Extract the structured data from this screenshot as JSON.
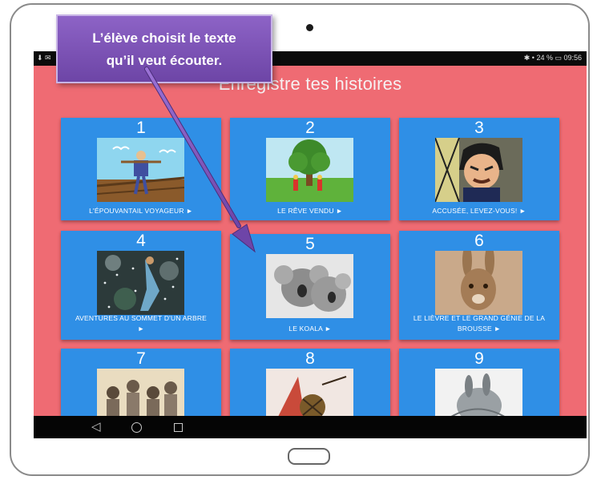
{
  "callout": {
    "line1": "L’élève choisit le texte",
    "line2": "qu’il veut écouter."
  },
  "statusbar": {
    "left_icons": "⬇ ✉",
    "right_text": "✱ • 24 % ▭ 09:56"
  },
  "app": {
    "title": "Enregistre tes histoires"
  },
  "cards": [
    {
      "number": "1",
      "label": "L'ÉPOUVANTAIL VOYAGEUR ►"
    },
    {
      "number": "2",
      "label": "LE RÊVE VENDU ►"
    },
    {
      "number": "3",
      "label": "ACCUSÉE, LEVEZ-VOUS! ►"
    },
    {
      "number": "4",
      "label_line1": "AVENTURES AU SOMMET D'UN ARBRE",
      "label_line2": "►"
    },
    {
      "number": "5",
      "label": "LE KOALA ►"
    },
    {
      "number": "6",
      "label_line1": "LE LIÈVRE ET LE GRAND GÉNIE DE LA",
      "label_line2": "BROUSSE ►"
    },
    {
      "number": "7"
    },
    {
      "number": "8"
    },
    {
      "number": "9"
    }
  ],
  "navbar": {
    "back": "◁"
  },
  "colors": {
    "screen_bg": "#ef6b73",
    "card_bg": "#2f8fe6",
    "callout_bg": "#7b52b6",
    "arrow": "#8a5cc8"
  }
}
